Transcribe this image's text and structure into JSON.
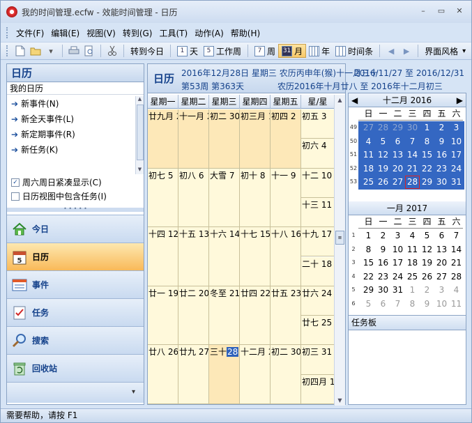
{
  "window": {
    "title": "我的时间管理.ecfw - 效能时间管理 - 日历",
    "min_glyph": "–",
    "max_glyph": "▭",
    "close_glyph": "✕"
  },
  "menu": [
    "文件(F)",
    "编辑(E)",
    "视图(V)",
    "转到(G)",
    "工具(T)",
    "动作(A)",
    "帮助(H)"
  ],
  "toolbar": {
    "goto_today": "转到今日",
    "day": "天",
    "work_week": "工作周",
    "week": "周",
    "month": "月",
    "year": "年",
    "timeline": "时间条",
    "theme": "界面风格",
    "day_icon": "1",
    "workweek_icon": "5",
    "week_icon": "7",
    "month_icon": "31",
    "prev_glyph": "◀",
    "next_glyph": "▶",
    "dropdown_glyph": "▾"
  },
  "left": {
    "header": "日历",
    "sub": "我的日历",
    "actions": [
      "新事件(N)",
      "新全天事件(L)",
      "新定期事件(R)",
      "新任务(K)"
    ],
    "checks": [
      {
        "label": "周六周日紧凑显示(C)",
        "checked": true
      },
      {
        "label": "日历视图中包含任务(I)",
        "checked": false
      }
    ],
    "nav": [
      {
        "label": "今日",
        "icon": "home-icon"
      },
      {
        "label": "日历",
        "icon": "calendar-icon"
      },
      {
        "label": "事件",
        "icon": "event-icon"
      },
      {
        "label": "任务",
        "icon": "task-icon"
      },
      {
        "label": "搜索",
        "icon": "search-icon"
      },
      {
        "label": "回收站",
        "icon": "recycle-icon"
      }
    ],
    "nav_footer": "▾"
  },
  "main": {
    "title": "日历",
    "line1": "2016年12月28日 星期三 农历丙申年(猴)十一月三十",
    "range": "2016/11/27 至 2016/12/31",
    "line2_week": "第53周 第363天",
    "line2_lunar": "农历2016年十月廿八 至 2016年十二月初三",
    "day_headers": [
      "星期一",
      "星期二",
      "星期三",
      "星期四",
      "星期五",
      "星/星"
    ],
    "weeks": [
      {
        "days": [
          "廿九月 28",
          "十一月 29",
          "初二 30",
          "初三月 1",
          "初四 2"
        ],
        "sat": "初五 3",
        "sun": "初六 4"
      },
      {
        "days": [
          "初七 5",
          "初八 6",
          "大雪 7",
          "初十 8",
          "十一 9"
        ],
        "sat": "十二 10",
        "sun": "十三 11"
      },
      {
        "days": [
          "十四 12",
          "十五 13",
          "十六 14",
          "十七 15",
          "十八 16"
        ],
        "sat": "十九 17",
        "sun": "二十 18"
      },
      {
        "days": [
          "廿一 19",
          "廿二 20",
          "冬至 21",
          "廿四 22",
          "廿五 23"
        ],
        "sat": "廿六 24",
        "sun": "廿七 25"
      },
      {
        "days": [
          "廿八 26",
          "廿九 27",
          "三十 28",
          "十二月 29",
          "初二 30"
        ],
        "sat": "初三 31",
        "sun": "初四月 1"
      }
    ]
  },
  "minical": {
    "weekdays": [
      "日",
      "一",
      "二",
      "三",
      "四",
      "五",
      "六"
    ],
    "dec": {
      "title": "十二月 2016",
      "weeks": [
        {
          "wk": "49",
          "days": [
            "27",
            "28",
            "29",
            "30",
            "1",
            "2",
            "3"
          ],
          "dim": [
            0,
            1,
            2,
            3
          ]
        },
        {
          "wk": "50",
          "days": [
            "4",
            "5",
            "6",
            "7",
            "8",
            "9",
            "10"
          ],
          "dim": []
        },
        {
          "wk": "51",
          "days": [
            "11",
            "12",
            "13",
            "14",
            "15",
            "16",
            "17"
          ],
          "dim": []
        },
        {
          "wk": "52",
          "days": [
            "18",
            "19",
            "20",
            "21",
            "22",
            "23",
            "24"
          ],
          "dim": []
        },
        {
          "wk": "53",
          "days": [
            "25",
            "26",
            "27",
            "28",
            "29",
            "30",
            "31"
          ],
          "dim": []
        }
      ]
    },
    "jan": {
      "title": "一月 2017",
      "weeks": [
        {
          "wk": "1",
          "days": [
            "1",
            "2",
            "3",
            "4",
            "5",
            "6",
            "7"
          ],
          "dim": []
        },
        {
          "wk": "2",
          "days": [
            "8",
            "9",
            "10",
            "11",
            "12",
            "13",
            "14"
          ],
          "dim": []
        },
        {
          "wk": "3",
          "days": [
            "15",
            "16",
            "17",
            "18",
            "19",
            "20",
            "21"
          ],
          "dim": []
        },
        {
          "wk": "4",
          "days": [
            "22",
            "23",
            "24",
            "25",
            "26",
            "27",
            "28"
          ],
          "dim": []
        },
        {
          "wk": "5",
          "days": [
            "29",
            "30",
            "31",
            "1",
            "2",
            "3",
            "4"
          ],
          "dim": [
            3,
            4,
            5,
            6
          ]
        },
        {
          "wk": "6",
          "days": [
            "5",
            "6",
            "7",
            "8",
            "9",
            "10",
            "11"
          ],
          "dim": [
            0,
            1,
            2,
            3,
            4,
            5,
            6
          ]
        }
      ]
    },
    "prev_glyph": "◀",
    "next_glyph": "▶",
    "taskboard": "任务板"
  },
  "status": "需要帮助，请按 F1",
  "colors": {
    "accent": "#3467c2",
    "cell": "#fff9db",
    "highlight": "#fde8b8",
    "nav_active": "#f9b959"
  }
}
